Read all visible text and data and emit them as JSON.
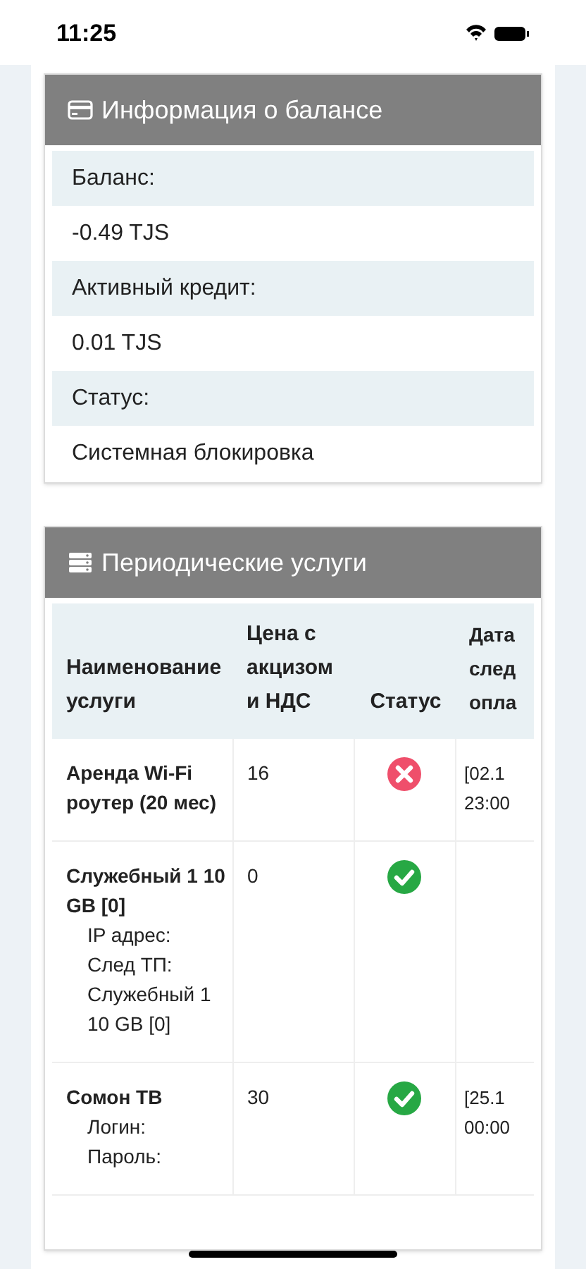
{
  "status_bar": {
    "time": "11:25"
  },
  "balance_card": {
    "title": "Информация о балансе",
    "rows": [
      {
        "kind": "label",
        "text": "Баланс:"
      },
      {
        "kind": "value",
        "text": "-0.49 TJS"
      },
      {
        "kind": "label",
        "text": "Активный кредит:"
      },
      {
        "kind": "value",
        "text": "0.01 TJS"
      },
      {
        "kind": "label",
        "text": "Статус:"
      },
      {
        "kind": "value",
        "text": "Системная блокировка"
      }
    ]
  },
  "services_card": {
    "title": "Периодические услуги",
    "table": {
      "columns": [
        "Наименование услуги",
        "Цена с акцизом и НДС",
        "Статус",
        "Дата след опла"
      ],
      "rows": [
        {
          "name": "Аренда Wi-Fi роутер (20 мес)",
          "details": [],
          "price": "16",
          "ok": false,
          "date": "[02.1 23:00"
        },
        {
          "name": "Служебный 1 10 GB [0]",
          "details": [
            "IP адрес:",
            "След ТП: Служебный 1 10 GB [0]"
          ],
          "price": "0",
          "ok": true
        },
        {
          "name": "Сомон ТВ",
          "details": [
            "Логин:",
            "Пароль:"
          ],
          "price": "30",
          "ok": true,
          "date": "[25.1 00:00"
        }
      ]
    }
  }
}
